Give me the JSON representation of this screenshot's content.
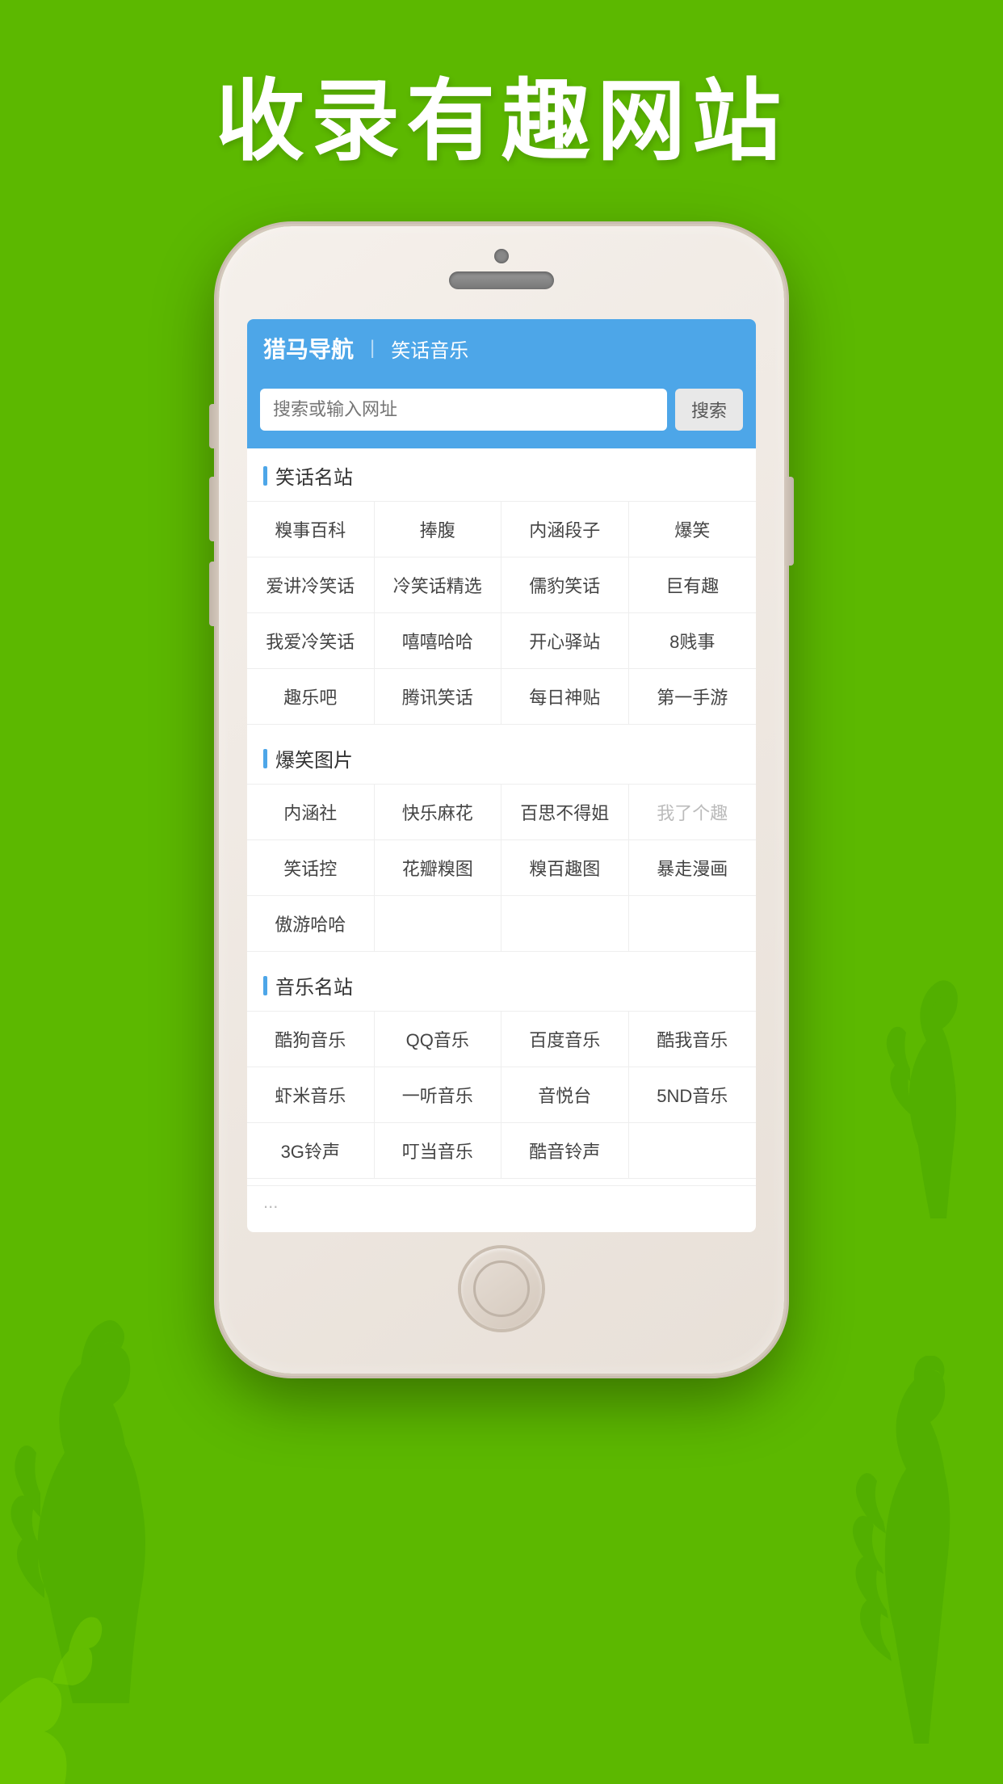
{
  "page": {
    "background_color": "#5cb800",
    "title": "收录有趣网站"
  },
  "app": {
    "header": {
      "brand": "猎马导航",
      "divider": "|",
      "category": "笑话音乐"
    },
    "search": {
      "placeholder": "搜索或输入网址",
      "button_label": "搜索"
    },
    "sections": [
      {
        "id": "jokes",
        "title": "笑话名站",
        "rows": [
          [
            "糗事百科",
            "捧腹",
            "内涵段子",
            "爆笑"
          ],
          [
            "爱讲冷笑话",
            "冷笑话精选",
            "儒豹笑话",
            "巨有趣"
          ],
          [
            "我爱冷笑话",
            "嘻嘻哈哈",
            "开心驿站",
            "8贱事"
          ],
          [
            "趣乐吧",
            "腾讯笑话",
            "每日神贴",
            "第一手游"
          ]
        ]
      },
      {
        "id": "images",
        "title": "爆笑图片",
        "rows": [
          [
            "内涵社",
            "快乐麻花",
            "百思不得姐",
            "我了个趣"
          ],
          [
            "笑话控",
            "花瓣糗图",
            "糗百趣图",
            "暴走漫画"
          ],
          [
            "傲游哈哈",
            "",
            "",
            ""
          ]
        ]
      },
      {
        "id": "music",
        "title": "音乐名站",
        "rows": [
          [
            "酷狗音乐",
            "QQ音乐",
            "百度音乐",
            "酷我音乐"
          ],
          [
            "虾米音乐",
            "一听音乐",
            "音悦台",
            "5ND音乐"
          ],
          [
            "3G铃声",
            "叮当音乐",
            "酷音铃声",
            ""
          ]
        ]
      }
    ]
  }
}
